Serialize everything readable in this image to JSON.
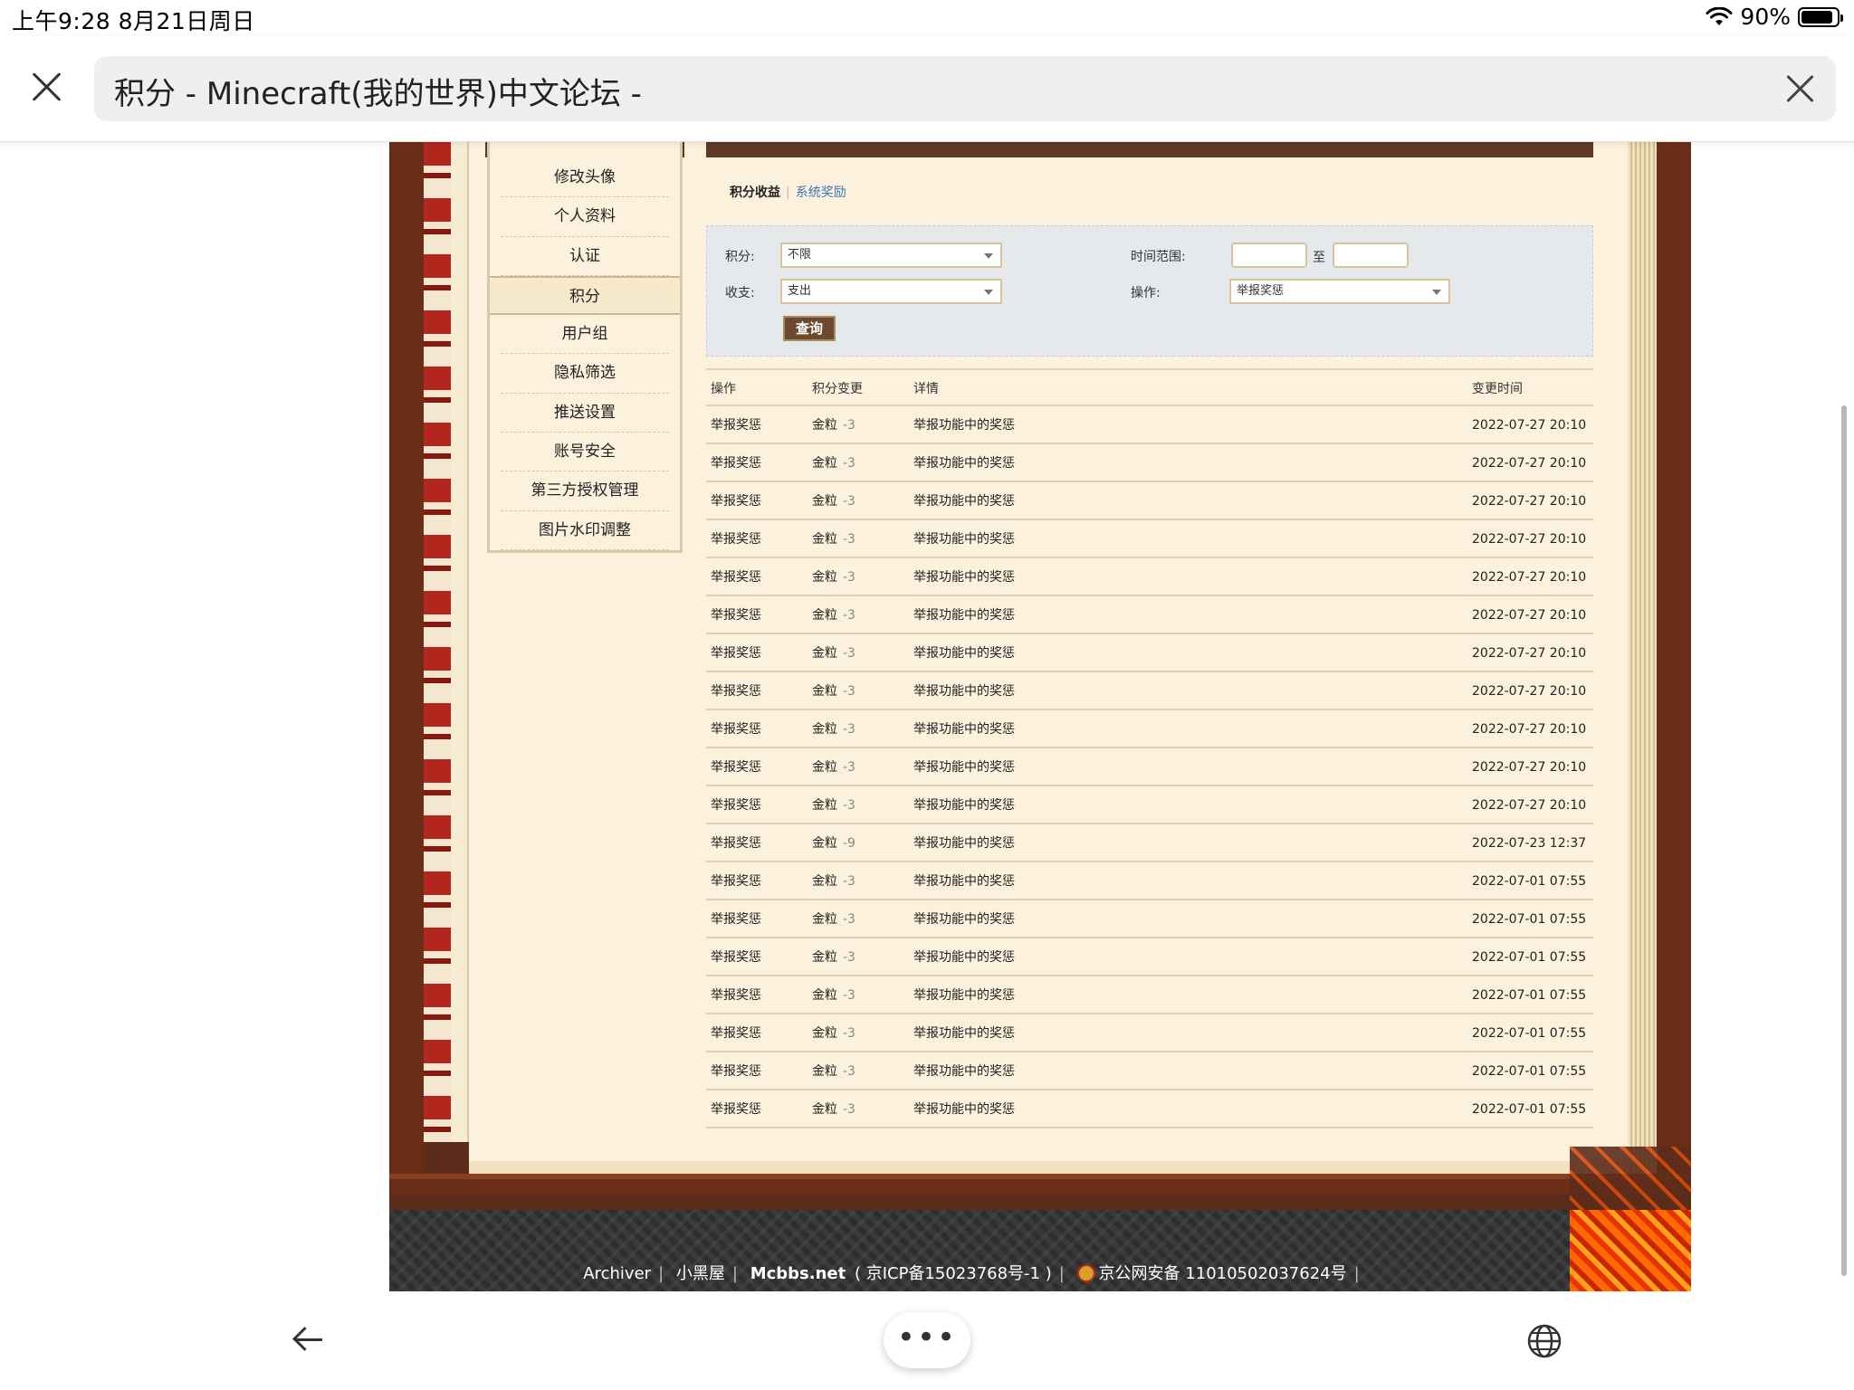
{
  "status_bar": {
    "time": "上午9:28   8月21日周日",
    "battery_percent": "90%",
    "battery_level": 0.9
  },
  "address_bar": {
    "title": "积分 - Minecraft(我的世界)中文论坛 -",
    "close_icon": "close-icon",
    "clear_icon": "clear-icon"
  },
  "side_menu": {
    "items": [
      {
        "label": "修改头像"
      },
      {
        "label": "个人资料"
      },
      {
        "label": "认证"
      },
      {
        "label": "积分",
        "active": true
      },
      {
        "label": "用户组"
      },
      {
        "label": "隐私筛选"
      },
      {
        "label": "推送设置"
      },
      {
        "label": "账号安全"
      },
      {
        "label": "第三方授权管理"
      },
      {
        "label": "图片水印调整"
      }
    ]
  },
  "subtabs": {
    "active": "积分收益",
    "link": "系统奖励"
  },
  "filter": {
    "credit_label": "积分:",
    "credit_value": "不限",
    "type_label": "收支:",
    "type_value": "支出",
    "time_label": "时间范围:",
    "time_to": "至",
    "op_label": "操作:",
    "op_value": "举报奖惩",
    "query_button": "查询"
  },
  "table": {
    "headers": {
      "op": "操作",
      "change": "积分变更",
      "detail": "详情",
      "time": "变更时间"
    },
    "rows": [
      {
        "op": "举报奖惩",
        "unit": "金粒",
        "amount": "-3",
        "detail": "举报功能中的奖惩",
        "time": "2022-07-27 20:10"
      },
      {
        "op": "举报奖惩",
        "unit": "金粒",
        "amount": "-3",
        "detail": "举报功能中的奖惩",
        "time": "2022-07-27 20:10"
      },
      {
        "op": "举报奖惩",
        "unit": "金粒",
        "amount": "-3",
        "detail": "举报功能中的奖惩",
        "time": "2022-07-27 20:10"
      },
      {
        "op": "举报奖惩",
        "unit": "金粒",
        "amount": "-3",
        "detail": "举报功能中的奖惩",
        "time": "2022-07-27 20:10"
      },
      {
        "op": "举报奖惩",
        "unit": "金粒",
        "amount": "-3",
        "detail": "举报功能中的奖惩",
        "time": "2022-07-27 20:10"
      },
      {
        "op": "举报奖惩",
        "unit": "金粒",
        "amount": "-3",
        "detail": "举报功能中的奖惩",
        "time": "2022-07-27 20:10"
      },
      {
        "op": "举报奖惩",
        "unit": "金粒",
        "amount": "-3",
        "detail": "举报功能中的奖惩",
        "time": "2022-07-27 20:10"
      },
      {
        "op": "举报奖惩",
        "unit": "金粒",
        "amount": "-3",
        "detail": "举报功能中的奖惩",
        "time": "2022-07-27 20:10"
      },
      {
        "op": "举报奖惩",
        "unit": "金粒",
        "amount": "-3",
        "detail": "举报功能中的奖惩",
        "time": "2022-07-27 20:10"
      },
      {
        "op": "举报奖惩",
        "unit": "金粒",
        "amount": "-3",
        "detail": "举报功能中的奖惩",
        "time": "2022-07-27 20:10"
      },
      {
        "op": "举报奖惩",
        "unit": "金粒",
        "amount": "-3",
        "detail": "举报功能中的奖惩",
        "time": "2022-07-27 20:10"
      },
      {
        "op": "举报奖惩",
        "unit": "金粒",
        "amount": "-9",
        "detail": "举报功能中的奖惩",
        "time": "2022-07-23 12:37"
      },
      {
        "op": "举报奖惩",
        "unit": "金粒",
        "amount": "-3",
        "detail": "举报功能中的奖惩",
        "time": "2022-07-01 07:55"
      },
      {
        "op": "举报奖惩",
        "unit": "金粒",
        "amount": "-3",
        "detail": "举报功能中的奖惩",
        "time": "2022-07-01 07:55"
      },
      {
        "op": "举报奖惩",
        "unit": "金粒",
        "amount": "-3",
        "detail": "举报功能中的奖惩",
        "time": "2022-07-01 07:55"
      },
      {
        "op": "举报奖惩",
        "unit": "金粒",
        "amount": "-3",
        "detail": "举报功能中的奖惩",
        "time": "2022-07-01 07:55"
      },
      {
        "op": "举报奖惩",
        "unit": "金粒",
        "amount": "-3",
        "detail": "举报功能中的奖惩",
        "time": "2022-07-01 07:55"
      },
      {
        "op": "举报奖惩",
        "unit": "金粒",
        "amount": "-3",
        "detail": "举报功能中的奖惩",
        "time": "2022-07-01 07:55"
      },
      {
        "op": "举报奖惩",
        "unit": "金粒",
        "amount": "-3",
        "detail": "举报功能中的奖惩",
        "time": "2022-07-01 07:55"
      }
    ]
  },
  "footer": {
    "archiver": "Archiver",
    "dark_room": "小黑屋",
    "site": "Mcbbs.net",
    "icp": "( 京ICP备15023768号-1 )",
    "police": "京公网安备 11010502037624号"
  },
  "toolbar": {
    "back_icon": "back-arrow-icon",
    "more_label": "•••",
    "globe_icon": "globe-icon"
  },
  "colors": {
    "paper": "#fbf1dc",
    "book_frame": "#5c2c1a",
    "link": "#3a78b5",
    "button": "#6b4a2f"
  }
}
